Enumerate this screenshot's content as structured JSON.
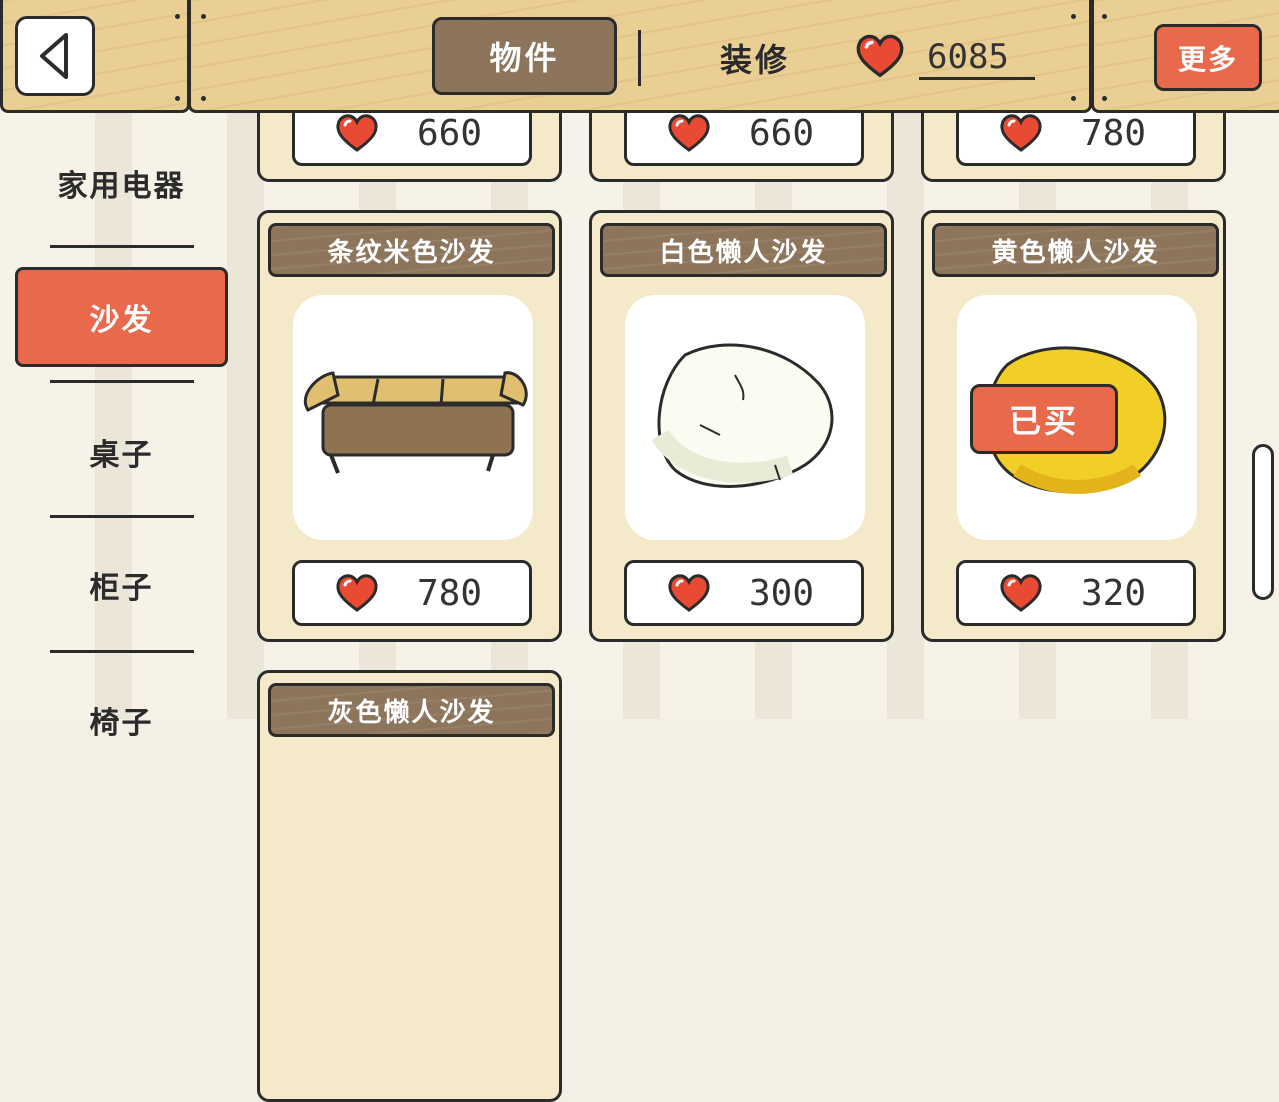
{
  "header": {
    "tabs": [
      {
        "label": "物件",
        "active": true
      },
      {
        "label": "装修",
        "active": false
      }
    ],
    "currency_value": "6085",
    "more_label": "更多"
  },
  "sidebar": {
    "items": [
      {
        "label": "家用电器",
        "active": false
      },
      {
        "label": "沙发",
        "active": true
      },
      {
        "label": "桌子",
        "active": false
      },
      {
        "label": "柜子",
        "active": false
      },
      {
        "label": "椅子",
        "active": false
      }
    ]
  },
  "top_row_prices": [
    "660",
    "660",
    "780"
  ],
  "items": [
    {
      "name": "条纹米色沙发",
      "price": "780",
      "bought": false
    },
    {
      "name": "白色懒人沙发",
      "price": "300",
      "bought": false
    },
    {
      "name": "黄色懒人沙发",
      "price": "320",
      "bought": true,
      "bought_label": "已买"
    },
    {
      "name": "灰色懒人沙发"
    }
  ],
  "colors": {
    "accent": "#e8694c",
    "wood": "#e9cf94",
    "plank_dark": "#8d755c",
    "card_bg": "#f4e9c8"
  },
  "icons": [
    "back-arrow-icon",
    "heart-icon"
  ]
}
